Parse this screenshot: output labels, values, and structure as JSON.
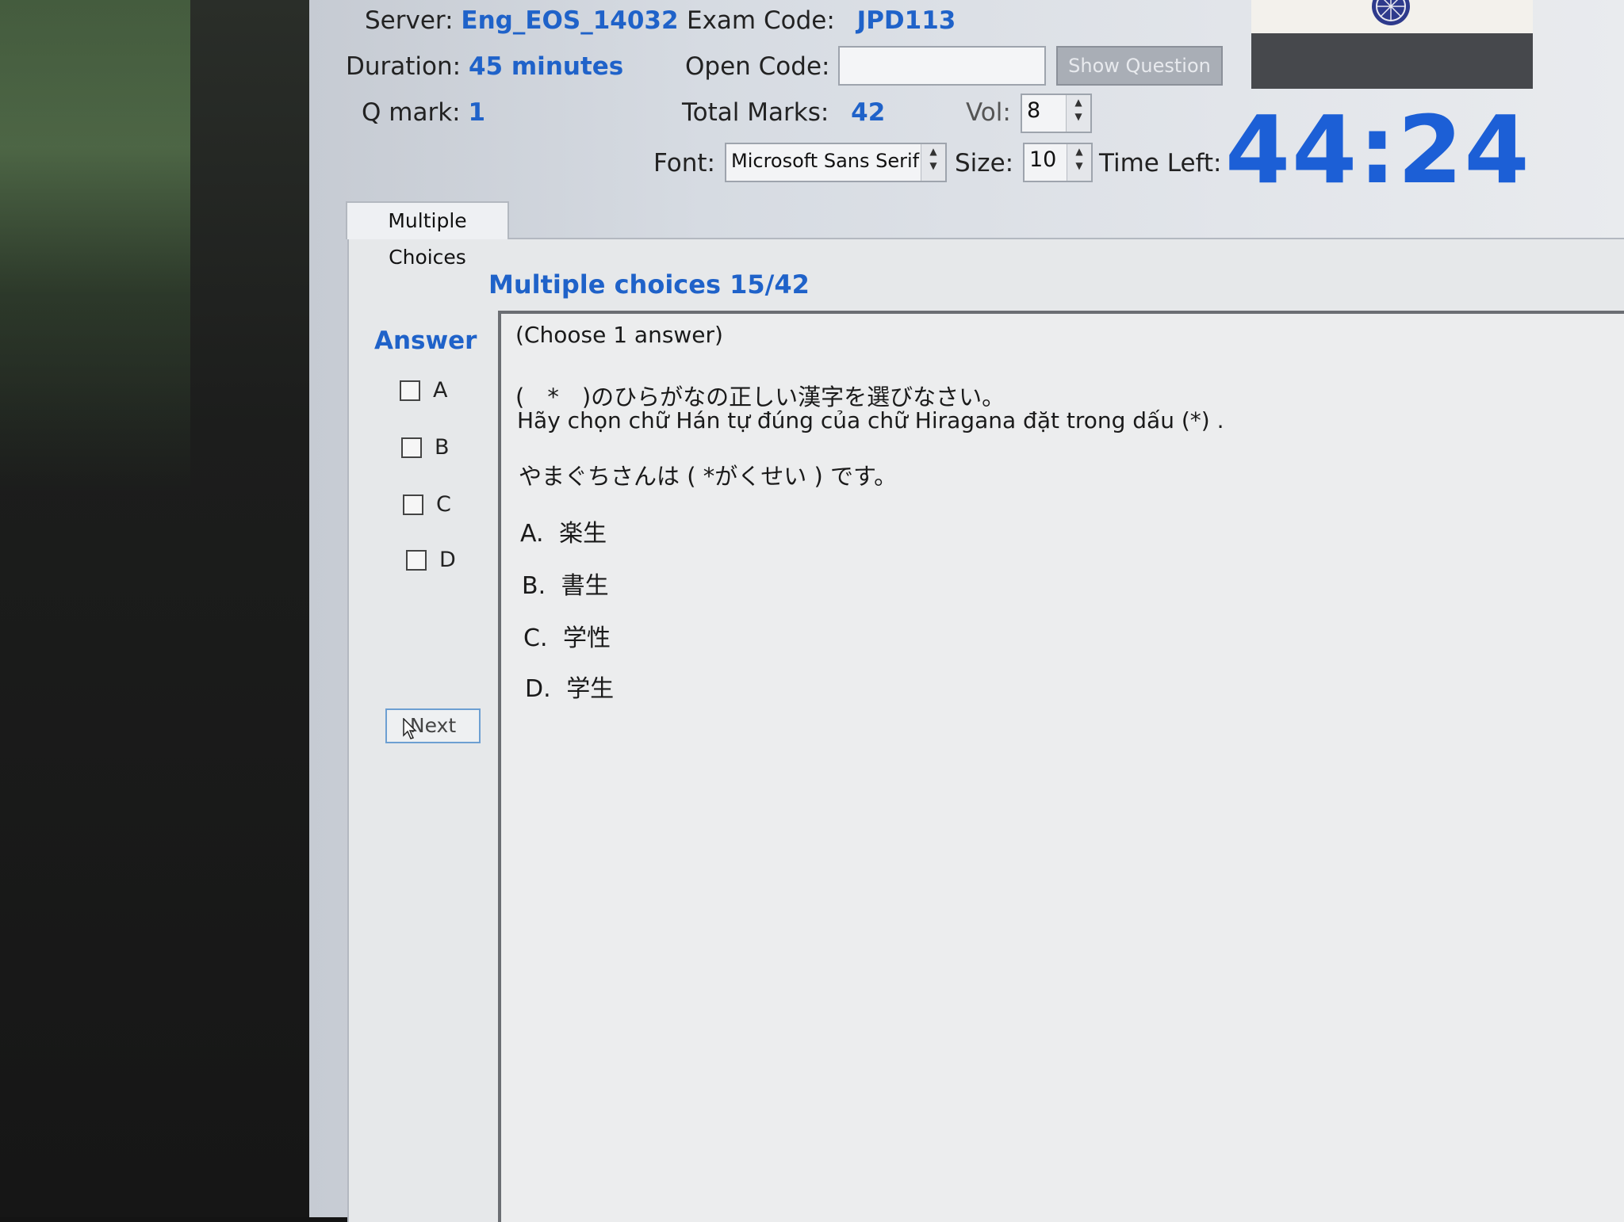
{
  "header": {
    "server_label": "Server:",
    "server_value": "Eng_EOS_14032",
    "exam_code_label": "Exam Code:",
    "exam_code_value": "JPD113",
    "duration_label": "Duration:",
    "duration_value": "45 minutes",
    "open_code_label": "Open Code:",
    "open_code_value": "",
    "show_question_label": "Show Question",
    "q_mark_label": "Q mark:",
    "q_mark_value": "1",
    "total_marks_label": "Total Marks:",
    "total_marks_value": "42",
    "vol_label": "Vol:",
    "vol_value": "8",
    "font_label": "Font:",
    "font_value": "Microsoft Sans Serif",
    "size_label": "Size:",
    "size_value": "10",
    "time_left_label": "Time Left:",
    "time_left_value": "44:24"
  },
  "tabs": [
    {
      "label": "Multiple Choices"
    }
  ],
  "question_panel": {
    "title": "Multiple choices 15/42",
    "answer_label": "Answer",
    "options": [
      {
        "label": "A",
        "checked": false
      },
      {
        "label": "B",
        "checked": false
      },
      {
        "label": "C",
        "checked": false
      },
      {
        "label": "D",
        "checked": false
      }
    ],
    "next_label": "Next"
  },
  "question": {
    "instruction": "(Choose 1 answer)",
    "prompt_jp": "(　*　)のひらがなの正しい漢字を選びなさい。",
    "prompt_vi": "Hãy chọn chữ Hán tự đúng của chữ Hiragana đặt trong dấu (*) .",
    "sentence": "やまぐちさんは ( *がくせい ) です。",
    "choices": [
      {
        "letter": "A.",
        "text": "楽生"
      },
      {
        "letter": "B.",
        "text": "書生"
      },
      {
        "letter": "C.",
        "text": "学性"
      },
      {
        "letter": "D.",
        "text": "学生"
      }
    ]
  },
  "colors": {
    "accent_blue": "#1f62c9",
    "timer_blue": "#1c5fd6"
  },
  "icons": [
    "emblem-icon",
    "spin-up-icon",
    "spin-down-icon",
    "mouse-cursor-icon"
  ]
}
